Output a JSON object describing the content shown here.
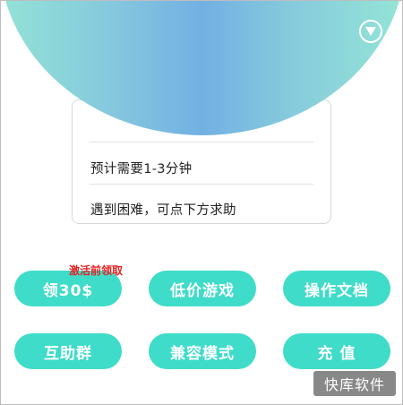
{
  "header": {
    "collapse_icon": "chevron-down-circle-icon",
    "gradient_colors": [
      "#93e3d6",
      "#72b0e3",
      "#94e5d6"
    ]
  },
  "info": {
    "line1": "预计需要1-3分钟",
    "line2": "遇到困难，可点下方求助"
  },
  "note": {
    "text": "激活前领取",
    "color": "#e32222"
  },
  "buttons": {
    "accent_color": "#3fdcc9",
    "row1": [
      "领30$",
      "低价游戏",
      "操作文档"
    ],
    "row2": [
      "互助群",
      "兼容模式",
      "充 值"
    ]
  },
  "watermark": {
    "text": "快库软件"
  }
}
